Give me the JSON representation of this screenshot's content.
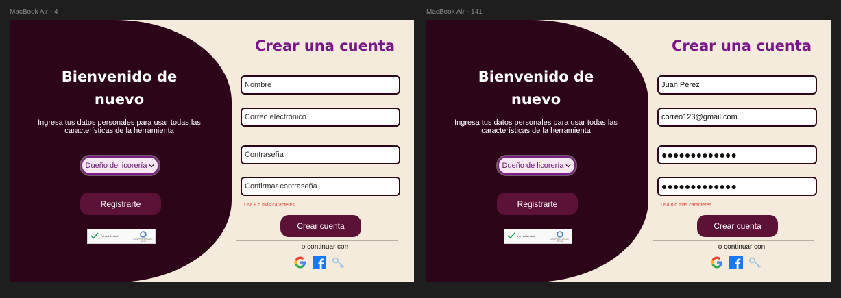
{
  "frames": [
    {
      "label": "MacBook Air - 4",
      "welcome_title_line1": "Bienvenido de",
      "welcome_title_line2": "nuevo",
      "welcome_subtitle": "Ingresa tus datos personales para usar todas las características de la herramienta",
      "role_select": "Dueño de licorería",
      "register_label": "Registrarte",
      "recaptcha_label": "I'm not a robot",
      "recaptcha_brand": "reCAPTCHA Privacy - Terms",
      "form_title": "Crear una cuenta",
      "fields": {
        "name": "Nombre",
        "email": "Correo electrónico",
        "password": "Contraseña",
        "confirm_password": "Confirmar contraseña"
      },
      "hint": "Usa 8 o más caracteres",
      "create_label": "Crear cuenta",
      "alt_text": "o continuar con"
    },
    {
      "label": "MacBook Air - 141",
      "welcome_title_line1": "Bienvenido de",
      "welcome_title_line2": "nuevo",
      "welcome_subtitle": "Ingresa tus datos personales para usar todas las características de la herramienta",
      "role_select": "Dueño de licorería",
      "register_label": "Registrarte",
      "recaptcha_label": "I'm not a robot",
      "recaptcha_brand": "reCAPTCHA Privacy - Terms",
      "form_title": "Crear una cuenta",
      "fields": {
        "name": "Juan Pérez",
        "email": "correo123@gmail.com",
        "password": "●●●●●●●●●●●●●",
        "confirm_password": "●●●●●●●●●●●●●"
      },
      "hint": "Usa 8 o más caracteres",
      "create_label": "Crear cuenta",
      "alt_text": "o continuar con"
    }
  ],
  "icons": [
    "google-icon",
    "facebook-icon",
    "key-icon",
    "chevron-down-icon",
    "checkmark-icon",
    "recaptcha-logo-icon"
  ],
  "colors": {
    "canvas": "#1e1e1e",
    "panel_dark": "#2c0519",
    "form_bg": "#f5ebdc",
    "accent_purple": "#7a1688",
    "button": "#5b1236",
    "hint_red": "#e0433c"
  }
}
